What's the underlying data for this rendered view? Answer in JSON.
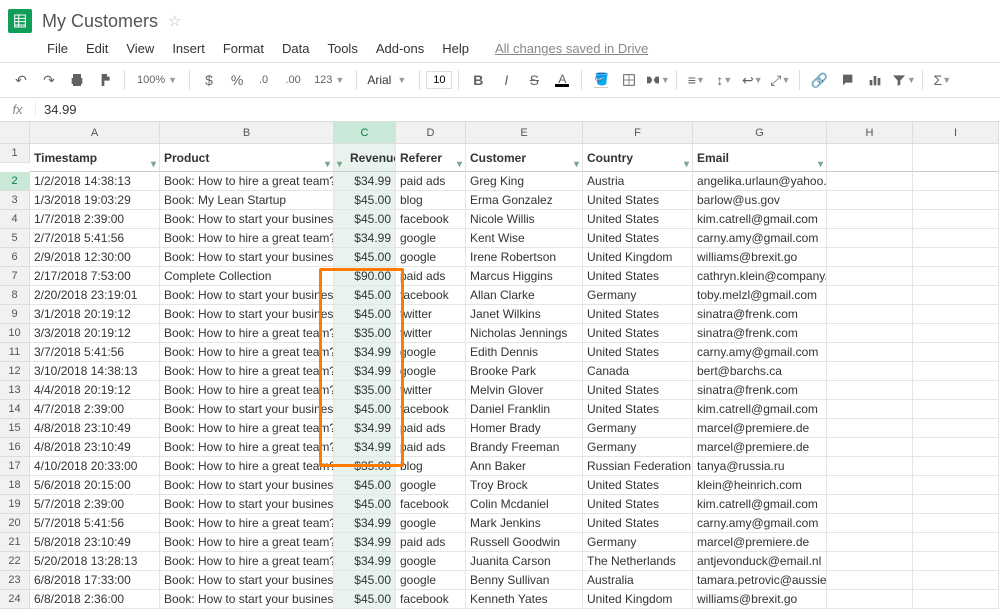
{
  "app": {
    "title": "My Customers",
    "saved": "All changes saved in Drive"
  },
  "menu": [
    "File",
    "Edit",
    "View",
    "Insert",
    "Format",
    "Data",
    "Tools",
    "Add-ons",
    "Help"
  ],
  "toolbar": {
    "zoom": "100%",
    "font": "Arial",
    "size": "10"
  },
  "formula": {
    "label": "fx",
    "value": "34.99"
  },
  "cols": [
    "A",
    "B",
    "C",
    "D",
    "E",
    "F",
    "G",
    "H",
    "I"
  ],
  "headers": [
    "Timestamp",
    "Product",
    "Revenue",
    "Referer",
    "Customer",
    "Country",
    "Email"
  ],
  "rows": [
    [
      "1/2/2018 14:38:13",
      "Book: How to hire a great team?",
      "$34.99",
      "paid ads",
      "Greg King",
      "Austria",
      "angelika.urlaun@yahoo.de"
    ],
    [
      "1/3/2018 19:03:29",
      "Book: My Lean Startup",
      "$45.00",
      "blog",
      "Erma Gonzalez",
      "United States",
      "barlow@us.gov"
    ],
    [
      "1/7/2018 2:39:00",
      "Book: How to start your business?",
      "$45.00",
      "facebook",
      "Nicole Willis",
      "United States",
      "kim.catrell@gmail.com"
    ],
    [
      "2/7/2018 5:41:56",
      "Book: How to hire a great team?",
      "$34.99",
      "google",
      "Kent Wise",
      "United States",
      "carny.amy@gmail.com"
    ],
    [
      "2/9/2018 12:30:00",
      "Book: How to start your business?",
      "$45.00",
      "google",
      "Irene Robertson",
      "United Kingdom",
      "williams@brexit.go"
    ],
    [
      "2/17/2018 7:53:00",
      "Complete Collection",
      "$90.00",
      "paid ads",
      "Marcus Higgins",
      "United States",
      "cathryn.klein@company.com"
    ],
    [
      "2/20/2018 23:19:01",
      "Book: How to start your business?",
      "$45.00",
      "facebook",
      "Allan Clarke",
      "Germany",
      "toby.melzl@gmail.com"
    ],
    [
      "3/1/2018 20:19:12",
      "Book: How to start your business?",
      "$45.00",
      "twitter",
      "Janet Wilkins",
      "United States",
      "sinatra@frenk.com"
    ],
    [
      "3/3/2018 20:19:12",
      "Book: How to hire a great team?",
      "$35.00",
      "twitter",
      "Nicholas Jennings",
      "United States",
      "sinatra@frenk.com"
    ],
    [
      "3/7/2018 5:41:56",
      "Book: How to hire a great team?",
      "$34.99",
      "google",
      "Edith Dennis",
      "United States",
      "carny.amy@gmail.com"
    ],
    [
      "3/10/2018 14:38:13",
      "Book: How to hire a great team?",
      "$34.99",
      "google",
      "Brooke Park",
      "Canada",
      "bert@barchs.ca"
    ],
    [
      "4/4/2018 20:19:12",
      "Book: How to hire a great team?",
      "$35.00",
      "twitter",
      "Melvin Glover",
      "United States",
      "sinatra@frenk.com"
    ],
    [
      "4/7/2018 2:39:00",
      "Book: How to start your business?",
      "$45.00",
      "facebook",
      "Daniel Franklin",
      "United States",
      "kim.catrell@gmail.com"
    ],
    [
      "4/8/2018 23:10:49",
      "Book: How to hire a great team?",
      "$34.99",
      "paid ads",
      "Homer Brady",
      "Germany",
      "marcel@premiere.de"
    ],
    [
      "4/8/2018 23:10:49",
      "Book: How to hire a great team?",
      "$34.99",
      "paid ads",
      "Brandy Freeman",
      "Germany",
      "marcel@premiere.de"
    ],
    [
      "4/10/2018 20:33:00",
      "Book: How to hire a great team?",
      "$35.00",
      "blog",
      "Ann Baker",
      "Russian Federation",
      "tanya@russia.ru"
    ],
    [
      "5/6/2018 20:15:00",
      "Book: How to start your business?",
      "$45.00",
      "google",
      "Troy Brock",
      "United States",
      "klein@heinrich.com"
    ],
    [
      "5/7/2018 2:39:00",
      "Book: How to start your business?",
      "$45.00",
      "facebook",
      "Colin Mcdaniel",
      "United States",
      "kim.catrell@gmail.com"
    ],
    [
      "5/7/2018 5:41:56",
      "Book: How to hire a great team?",
      "$34.99",
      "google",
      "Mark Jenkins",
      "United States",
      "carny.amy@gmail.com"
    ],
    [
      "5/8/2018 23:10:49",
      "Book: How to hire a great team?",
      "$34.99",
      "paid ads",
      "Russell Goodwin",
      "Germany",
      "marcel@premiere.de"
    ],
    [
      "5/20/2018 13:28:13",
      "Book: How to hire a great team?",
      "$34.99",
      "google",
      "Juanita Carson",
      "The Netherlands",
      "antjevonduck@email.nl"
    ],
    [
      "6/8/2018 17:33:00",
      "Book: How to start your business?",
      "$45.00",
      "google",
      "Benny Sullivan",
      "Australia",
      "tamara.petrovic@aussie.au"
    ],
    [
      "6/8/2018 2:36:00",
      "Book: How to start your business?",
      "$45.00",
      "facebook",
      "Kenneth Yates",
      "United Kingdom",
      "williams@brexit.go"
    ]
  ]
}
